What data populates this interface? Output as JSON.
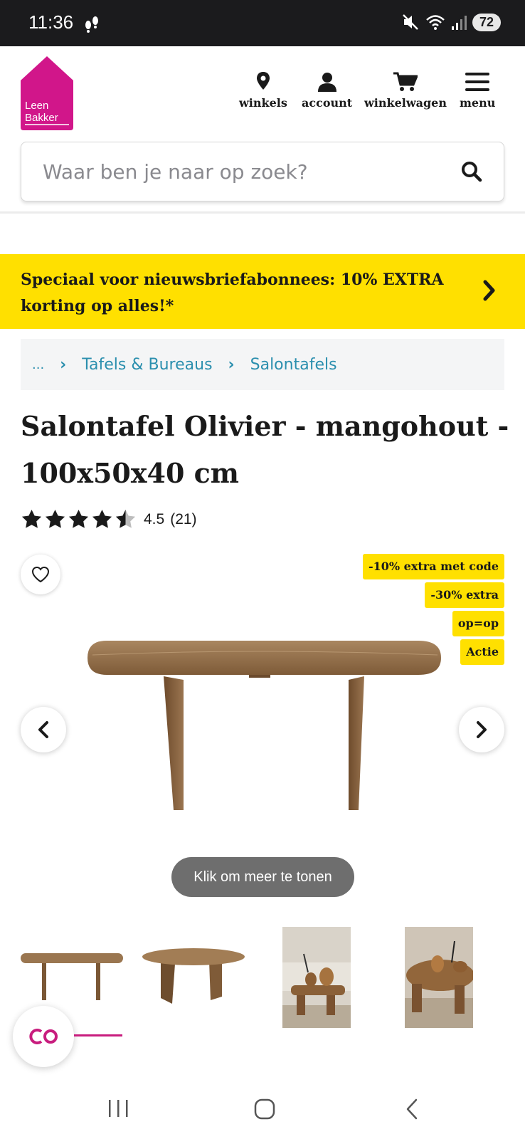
{
  "status_bar": {
    "time": "11:36",
    "battery": "72"
  },
  "header": {
    "logo_line1": "Leen",
    "logo_line2": "Bakker",
    "brand_color": "#d1168a",
    "nav": [
      {
        "label": "winkels",
        "icon": "location-pin-icon"
      },
      {
        "label": "account",
        "icon": "user-icon"
      },
      {
        "label": "winkelwagen",
        "icon": "cart-icon"
      },
      {
        "label": "menu",
        "icon": "hamburger-menu-icon"
      }
    ],
    "search_placeholder": "Waar ben je naar op zoek?"
  },
  "promo": {
    "text": "Speciaal voor nieuwsbriefabonnees: 10% EXTRA korting op alles!*",
    "color": "#ffe000"
  },
  "breadcrumb": [
    "...",
    "Tafels & Bureaus",
    "Salontafels"
  ],
  "product": {
    "title": "Salontafel Olivier - mangohout - 100x50x40 cm",
    "rating": "4.5",
    "review_count": "(21)",
    "rating_value": 4.5,
    "badges": [
      "-10% extra met code",
      "-30% extra",
      "op=op",
      "Actie"
    ],
    "show_more": "Klik om meer te tonen"
  }
}
